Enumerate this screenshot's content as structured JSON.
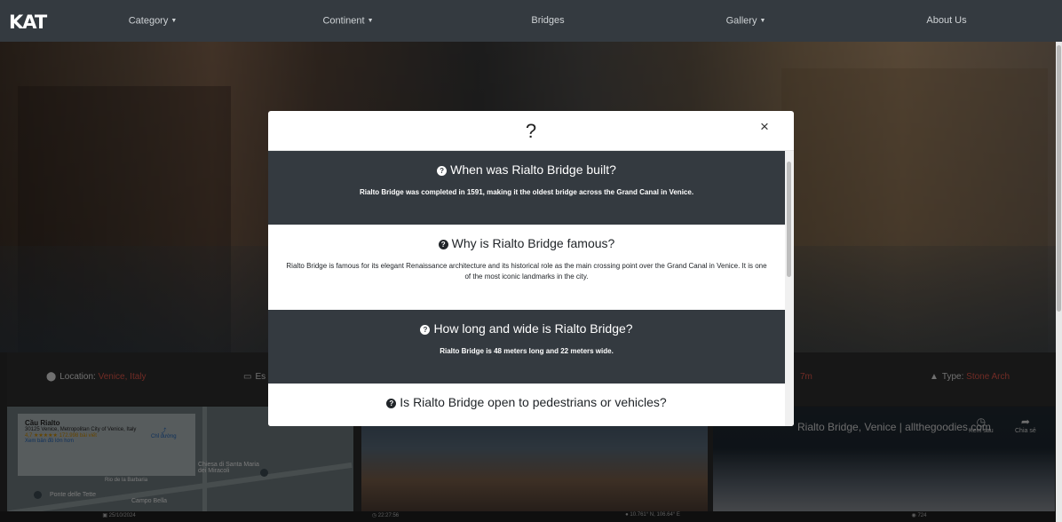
{
  "nav": {
    "logo": "KAT",
    "items": [
      "Category",
      "Continent",
      "Bridges",
      "Gallery",
      "About Us"
    ]
  },
  "info": {
    "location_label": "Location:",
    "location_value": "Venice, Italy",
    "est_label": "Es",
    "height_value": "7m",
    "type_label": "Type:",
    "type_value": "Stone Arch"
  },
  "map": {
    "title": "Cầu Rialto",
    "address": "30125 Venice, Metropolitan City of Venice, Italy",
    "rating": "4,7 ★★★★★ 172.998 bài viết",
    "directions": "Chỉ đường",
    "larger_map": "Xem bản đồ lớn hơn",
    "place1": "Chiesa di Santa Maria dei Miracoli",
    "place2": "Ponte delle Tette",
    "place3": "Campo Bella",
    "place4": "Rio de la Barbaria"
  },
  "video": {
    "title": "Rialto Bridge, Venice | allthegoodies.com",
    "watch_later": "Xem sau",
    "share": "Chia sẻ"
  },
  "footer": {
    "date": "25/10/2024",
    "time": "22:27:56",
    "coords": "10.761° N, 106.64° E",
    "visits": "724"
  },
  "modal": {
    "title": "?",
    "close": "×",
    "faqs": [
      {
        "q": "When was Rialto Bridge built?",
        "a": "Rialto Bridge was completed in 1591, making it the oldest bridge across the Grand Canal in Venice."
      },
      {
        "q": "Why is Rialto Bridge famous?",
        "a": "Rialto Bridge is famous for its elegant Renaissance architecture and its historical role as the main crossing point over the Grand Canal in Venice. It is one of the most iconic landmarks in the city."
      },
      {
        "q": "How long and wide is Rialto Bridge?",
        "a": "Rialto Bridge is 48 meters long and 22 meters wide."
      },
      {
        "q": "Is Rialto Bridge open to pedestrians or vehicles?",
        "a": ""
      }
    ]
  }
}
